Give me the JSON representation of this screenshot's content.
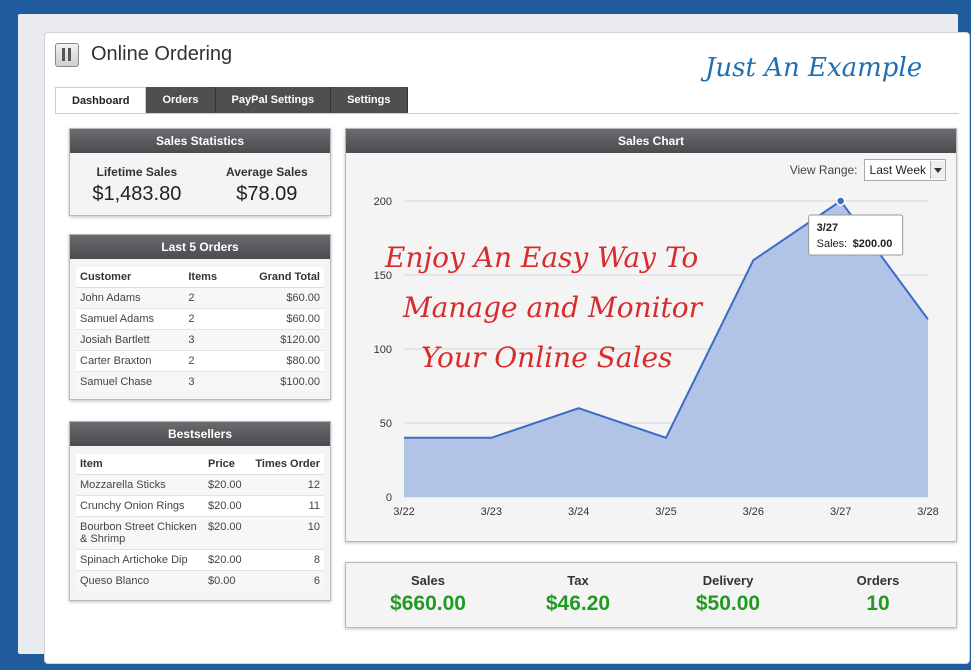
{
  "header": {
    "title": "Online Ordering",
    "watermark": "Just An Example"
  },
  "tabs": [
    "Dashboard",
    "Orders",
    "PayPal Settings",
    "Settings"
  ],
  "sales_statistics": {
    "title": "Sales Statistics",
    "lifetime_label": "Lifetime Sales",
    "lifetime_value": "$1,483.80",
    "average_label": "Average Sales",
    "average_value": "$78.09"
  },
  "last_orders": {
    "title": "Last 5 Orders",
    "columns": [
      "Customer",
      "Items",
      "Grand Total"
    ],
    "rows": [
      [
        "John Adams",
        "2",
        "$60.00"
      ],
      [
        "Samuel Adams",
        "2",
        "$60.00"
      ],
      [
        "Josiah Bartlett",
        "3",
        "$120.00"
      ],
      [
        "Carter Braxton",
        "2",
        "$80.00"
      ],
      [
        "Samuel Chase",
        "3",
        "$100.00"
      ]
    ]
  },
  "bestsellers": {
    "title": "Bestsellers",
    "columns": [
      "Item",
      "Price",
      "Times Order"
    ],
    "rows": [
      [
        "Mozzarella Sticks",
        "$20.00",
        "12"
      ],
      [
        "Crunchy Onion Rings",
        "$20.00",
        "11"
      ],
      [
        "Bourbon Street Chicken & Shrimp",
        "$20.00",
        "10"
      ],
      [
        "Spinach Artichoke Dip",
        "$20.00",
        "8"
      ],
      [
        "Queso Blanco",
        "$0.00",
        "6"
      ]
    ]
  },
  "sales_chart": {
    "title": "Sales Chart",
    "view_range_label": "View Range:",
    "view_range_value": "Last Week",
    "tooltip_date": "3/27",
    "tooltip_label": "Sales:",
    "tooltip_value": "$200.00"
  },
  "promo": {
    "line1": "Enjoy An Easy Way To",
    "line2": "Manage and Monitor",
    "line3": "Your Online Sales"
  },
  "totals": [
    {
      "label": "Sales",
      "value": "$660.00"
    },
    {
      "label": "Tax",
      "value": "$46.20"
    },
    {
      "label": "Delivery",
      "value": "$50.00"
    },
    {
      "label": "Orders",
      "value": "10"
    }
  ],
  "colors": {
    "accent": "#229a22",
    "area": "#b1c3e6",
    "line": "#3a6cc6",
    "promo": "#d92b2b"
  },
  "chart_data": {
    "type": "area",
    "x": [
      "3/22",
      "3/23",
      "3/24",
      "3/25",
      "3/26",
      "3/27",
      "3/28"
    ],
    "series": [
      {
        "values": [
          40,
          40,
          60,
          40,
          160,
          200,
          120
        ]
      }
    ],
    "ylim": [
      0,
      200
    ],
    "yticks": [
      0,
      50,
      100,
      150,
      200
    ],
    "grid": true,
    "title": "Sales Chart"
  }
}
